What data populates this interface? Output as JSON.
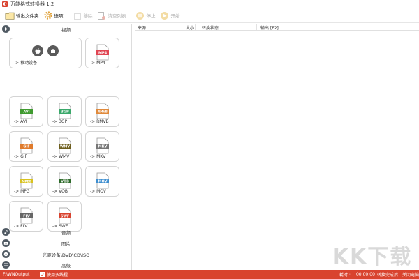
{
  "window": {
    "title": "万能格式转换器 1.2"
  },
  "toolbar": {
    "output_folder": "输出文件夹",
    "options": "选项",
    "remove": "移除",
    "clear_list": "清空列表",
    "stop": "停止",
    "start": "开始"
  },
  "categories": {
    "video": "视频",
    "audio": "音频",
    "image": "图片",
    "disc": "光驱设备\\DVD\\CD\\ISO",
    "advanced": "高级"
  },
  "formats": [
    {
      "badge": "",
      "label": "-> 移动设备",
      "color": "#555555"
    },
    {
      "badge": "MP4",
      "label": "-> MP4",
      "color": "#e04552"
    },
    {
      "badge": "AVI",
      "label": "-> AVI",
      "color": "#3f9a2f"
    },
    {
      "badge": "3GP",
      "label": "-> 3GP",
      "color": "#3aa86a"
    },
    {
      "badge": "RMVB",
      "label": "-> RMVB",
      "color": "#e08a3c"
    },
    {
      "badge": "GIF",
      "label": "-> GIF",
      "color": "#e07b2c"
    },
    {
      "badge": "WMV",
      "label": "-> WMV",
      "color": "#6e5f1e"
    },
    {
      "badge": "MKV",
      "label": "-> MKV",
      "color": "#767676"
    },
    {
      "badge": "MPEG",
      "label": "-> MPG",
      "color": "#d8c21f"
    },
    {
      "badge": "VOB",
      "label": "-> VOB",
      "color": "#2e6b2a"
    },
    {
      "badge": "MOV",
      "label": "-> MOV",
      "color": "#3f8fd0"
    },
    {
      "badge": "FLV",
      "label": "-> FLV",
      "color": "#666666"
    },
    {
      "badge": "SWF",
      "label": "-> SWF",
      "color": "#d9432f"
    }
  ],
  "table": {
    "columns": [
      "来源",
      "大小",
      "转换状态",
      "输出 [F2]"
    ]
  },
  "statusbar": {
    "output_path": "F:\\WNOutput",
    "use_multithread": "使用多线程",
    "elapsed_label": "耗时 :",
    "elapsed_value": "00:00:00",
    "after_convert": "转换完成后：关闭电脑"
  },
  "watermark": {
    "text": "KK下载"
  },
  "colors": {
    "accent": "#d9432f",
    "disabled": "#aaaaaa"
  }
}
